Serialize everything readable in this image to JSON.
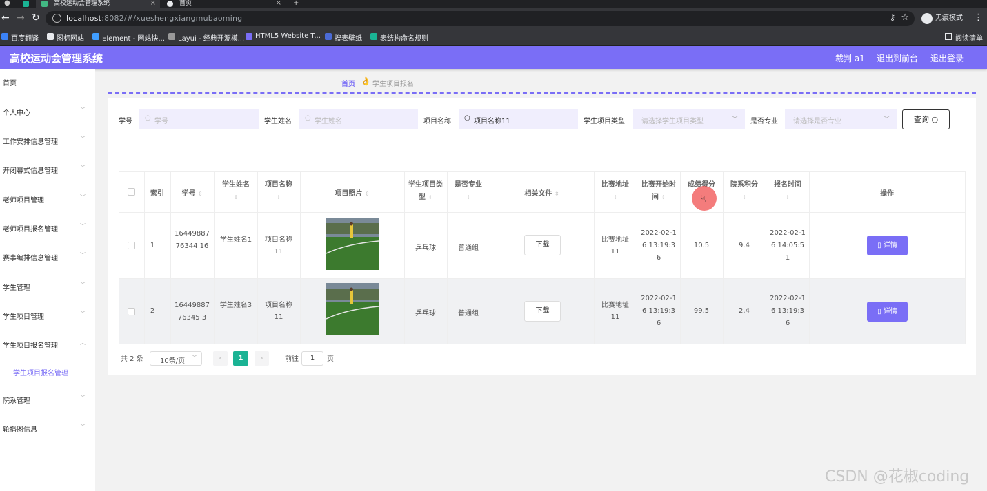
{
  "browser": {
    "tabs": [
      {
        "title": "高校运动会管理系统",
        "active": true
      },
      {
        "title": "首页",
        "active": false
      }
    ],
    "url_host": "localhost",
    "url_rest": ":8082/#/xueshengxiangmubaoming",
    "incognito_label": "无痕模式",
    "bookmarks": [
      "百度翻译",
      "图标网站",
      "Element - 网站快...",
      "Layui - 经典开源模...",
      "HTML5 Website T...",
      "搜表壁纸",
      "表结构命名规则"
    ],
    "reading_list": "阅读清单"
  },
  "header": {
    "title": "高校运动会管理系统",
    "user": "裁判 a1",
    "front": "退出到前台",
    "logout": "退出登录"
  },
  "sidebar": {
    "items": [
      "首页",
      "个人中心",
      "工作安排信息管理",
      "开闭幕式信息管理",
      "老师项目管理",
      "老师项目报名管理",
      "赛事编排信息管理",
      "学生管理",
      "学生项目管理",
      "学生项目报名管理",
      "学生项目报名管理",
      "院系管理",
      "轮播图信息"
    ]
  },
  "breadcrumb": {
    "home": "首页",
    "current": "学生项目报名"
  },
  "filters": {
    "student_no_label": "学号",
    "student_no_placeholder": "学号",
    "student_name_label": "学生姓名",
    "student_name_placeholder": "学生姓名",
    "project_name_label": "项目名称",
    "project_name_value": "项目名称11",
    "type_label": "学生项目类型",
    "type_placeholder": "请选择学生项目类型",
    "pro_label": "是否专业",
    "pro_placeholder": "请选择是否专业",
    "query": "查询"
  },
  "table": {
    "headers": {
      "index": "索引",
      "student_no": "学号",
      "student_name": "学生姓名",
      "project_name": "项目名称",
      "photo": "项目照片",
      "type": "学生项目类型",
      "pro": "是否专业",
      "file": "相关文件",
      "address": "比赛地址",
      "start": "比赛开始时间",
      "score": "成绩得分",
      "dept_points": "院系积分",
      "signup": "报名时间",
      "action": "操作"
    },
    "rows": [
      {
        "index": "1",
        "student_no": "1644988776344 16",
        "student_name": "学生姓名1",
        "project_name": "项目名称11",
        "type": "乒乓球",
        "pro": "普通组",
        "file": "下载",
        "address": "比赛地址11",
        "start": "2022-02-16 13:19:36",
        "score": "10.5",
        "dept_points": "9.4",
        "signup": "2022-02-16 14:05:51",
        "action": "详情"
      },
      {
        "index": "2",
        "student_no": "1644988776345 3",
        "student_name": "学生姓名3",
        "project_name": "项目名称11",
        "type": "乒乓球",
        "pro": "普通组",
        "file": "下载",
        "address": "比赛地址11",
        "start": "2022-02-16 13:19:36",
        "score": "99.5",
        "dept_points": "2.4",
        "signup": "2022-02-16 13:19:36",
        "action": "详情"
      }
    ]
  },
  "pagination": {
    "total": "共 2 条",
    "page_size": "10条/页",
    "current": "1",
    "goto": "前往",
    "goto_value": "1",
    "page_unit": "页"
  },
  "watermark": "CSDN @花椒coding",
  "colors": {
    "accent": "#7a6ef6",
    "page_active": "#1ab394"
  }
}
